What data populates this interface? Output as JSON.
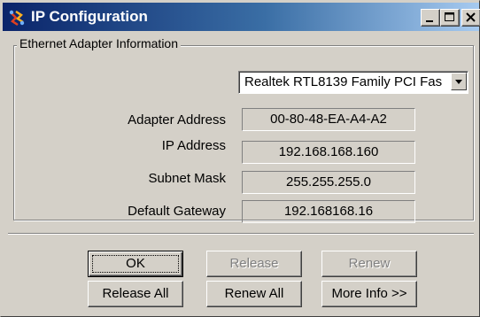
{
  "window": {
    "title": "IP Configuration",
    "app_icon": "network-config-icon",
    "controls": {
      "minimize": "minimize-icon",
      "maximize": "maximize-icon",
      "close": "close-icon"
    }
  },
  "group": {
    "legend": "Ethernet  Adapter Information"
  },
  "adapter": {
    "selected": "Realtek RTL8139 Family PCI Fas"
  },
  "fields": {
    "adapter_address": {
      "label": "Adapter Address",
      "value": "00-80-48-EA-A4-A2"
    },
    "ip_address": {
      "label": "IP Address",
      "value": "192.168.168.160"
    },
    "subnet_mask": {
      "label": "Subnet Mask",
      "value": "255.255.255.0"
    },
    "default_gateway": {
      "label": "Default Gateway",
      "value": "192.168168.16"
    }
  },
  "buttons": {
    "ok": {
      "label": "OK",
      "enabled": true,
      "default": true
    },
    "release": {
      "label": "Release",
      "enabled": false
    },
    "renew": {
      "label": "Renew",
      "enabled": false
    },
    "release_all": {
      "label": "Release All",
      "enabled": true
    },
    "renew_all": {
      "label": "Renew All",
      "enabled": true
    },
    "more_info": {
      "label": "More Info >>",
      "enabled": true
    }
  },
  "colors": {
    "titlebar_start": "#0a246a",
    "titlebar_end": "#a6caf0",
    "face": "#d4d0c8"
  }
}
